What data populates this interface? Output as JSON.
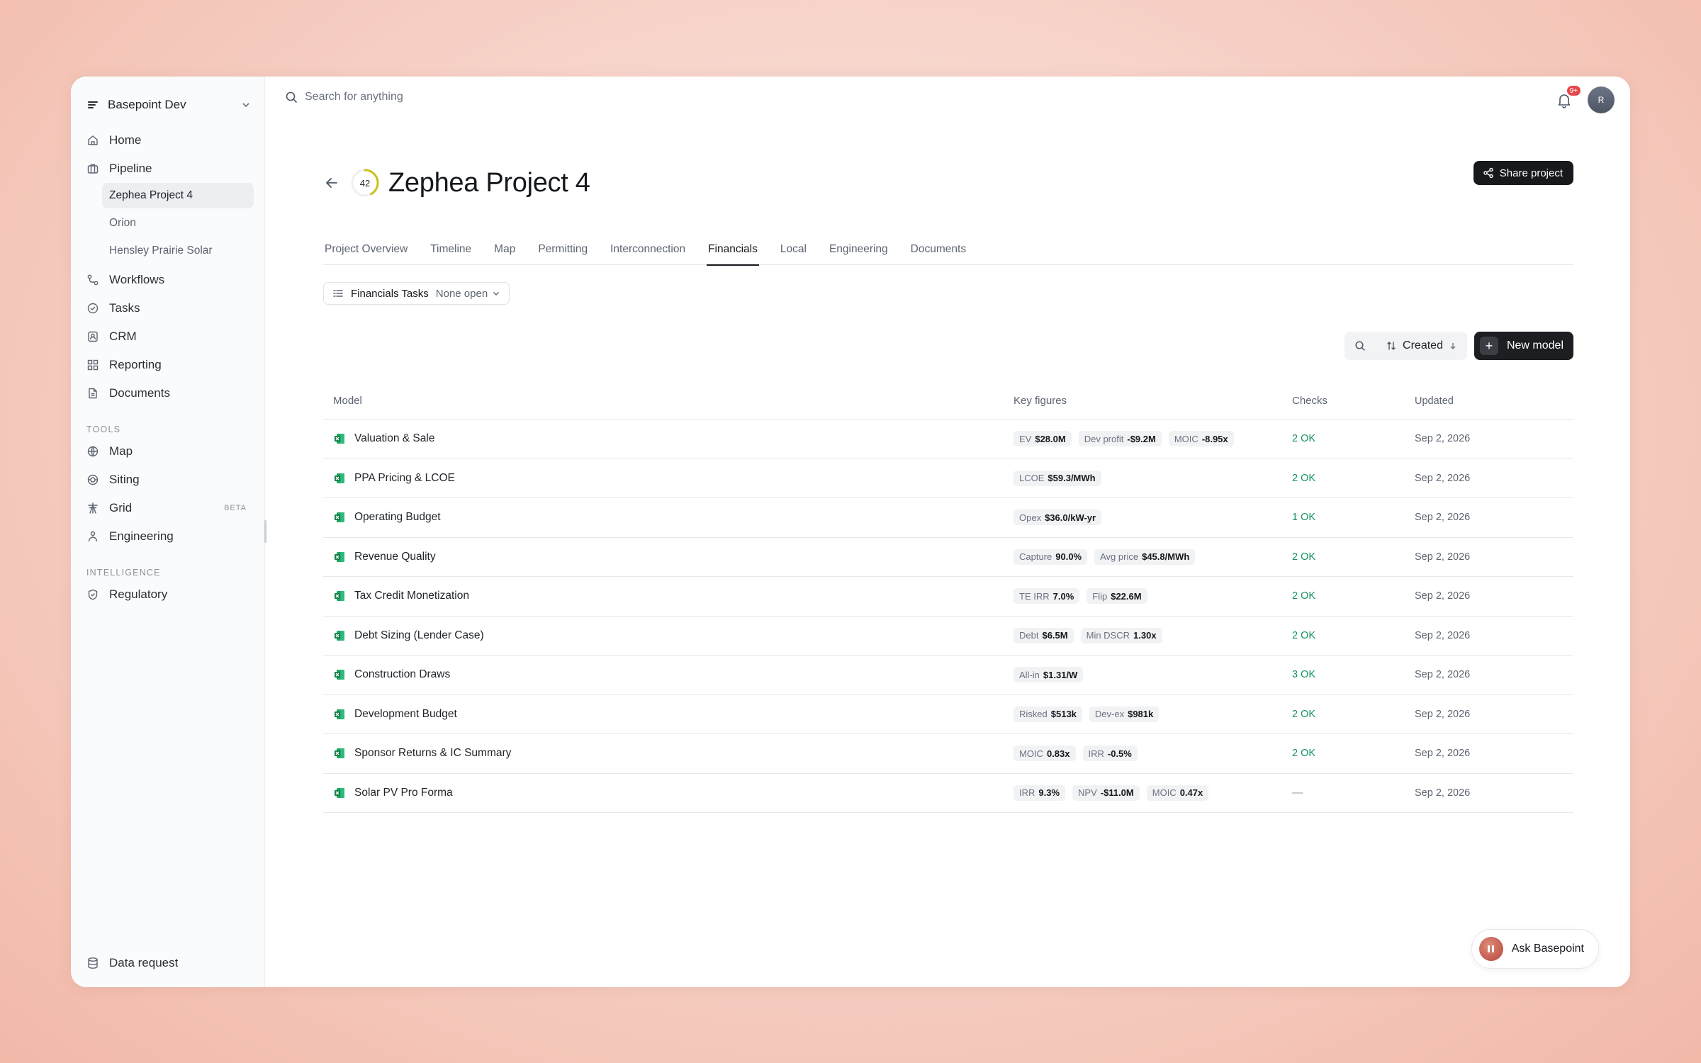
{
  "workspace": {
    "name": "Basepoint Dev"
  },
  "sidebar": {
    "nav": [
      {
        "label": "Home",
        "icon": "home-icon"
      },
      {
        "label": "Pipeline",
        "icon": "briefcase-icon"
      }
    ],
    "pipeline_items": [
      "Zephea Project 4",
      "Orion",
      "Hensley Prairie Solar"
    ],
    "nav2": [
      {
        "label": "Workflows",
        "icon": "workflow-icon"
      },
      {
        "label": "Tasks",
        "icon": "check-circle-icon"
      },
      {
        "label": "CRM",
        "icon": "contact-icon"
      },
      {
        "label": "Reporting",
        "icon": "grid-icon"
      },
      {
        "label": "Documents",
        "icon": "document-icon"
      }
    ],
    "tools_label": "TOOLS",
    "tools": [
      {
        "label": "Map",
        "icon": "globe-icon"
      },
      {
        "label": "Siting",
        "icon": "siting-icon"
      },
      {
        "label": "Grid",
        "icon": "tower-icon",
        "badge": "BETA"
      },
      {
        "label": "Engineering",
        "icon": "engineer-icon"
      }
    ],
    "intelligence_label": "INTELLIGENCE",
    "intelligence": [
      {
        "label": "Regulatory",
        "icon": "shield-icon"
      }
    ],
    "footer": {
      "label": "Data request",
      "icon": "database-icon"
    }
  },
  "topbar": {
    "search_placeholder": "Search for anything",
    "notification_badge": "9+",
    "avatar_initial": "R"
  },
  "project": {
    "score": "42",
    "score_fraction": 0.42,
    "title": "Zephea Project 4",
    "share_label": "Share project"
  },
  "tabs": [
    "Project Overview",
    "Timeline",
    "Map",
    "Permitting",
    "Interconnection",
    "Financials",
    "Local",
    "Engineering",
    "Documents"
  ],
  "active_tab": "Financials",
  "tasks_filter": {
    "label": "Financials Tasks",
    "value": "None open"
  },
  "toolbar": {
    "sort_label": "Created",
    "new_label": "New model"
  },
  "table": {
    "headers": {
      "model": "Model",
      "key": "Key figures",
      "checks": "Checks",
      "updated": "Updated"
    },
    "rows": [
      {
        "model": "Valuation & Sale",
        "figures": [
          {
            "k": "EV",
            "v": "$28.0M"
          },
          {
            "k": "Dev profit",
            "v": "-$9.2M"
          },
          {
            "k": "MOIC",
            "v": "-8.95x"
          }
        ],
        "checks": "2 OK",
        "updated": "Sep 2, 2026"
      },
      {
        "model": "PPA Pricing & LCOE",
        "figures": [
          {
            "k": "LCOE",
            "v": "$59.3/MWh"
          }
        ],
        "checks": "2 OK",
        "updated": "Sep 2, 2026"
      },
      {
        "model": "Operating Budget",
        "figures": [
          {
            "k": "Opex",
            "v": "$36.0/kW-yr"
          }
        ],
        "checks": "1 OK",
        "updated": "Sep 2, 2026"
      },
      {
        "model": "Revenue Quality",
        "figures": [
          {
            "k": "Capture",
            "v": "90.0%"
          },
          {
            "k": "Avg price",
            "v": "$45.8/MWh"
          }
        ],
        "checks": "2 OK",
        "updated": "Sep 2, 2026"
      },
      {
        "model": "Tax Credit Monetization",
        "figures": [
          {
            "k": "TE IRR",
            "v": "7.0%"
          },
          {
            "k": "Flip",
            "v": "$22.6M"
          }
        ],
        "checks": "2 OK",
        "updated": "Sep 2, 2026"
      },
      {
        "model": "Debt Sizing (Lender Case)",
        "figures": [
          {
            "k": "Debt",
            "v": "$6.5M"
          },
          {
            "k": "Min DSCR",
            "v": "1.30x"
          }
        ],
        "checks": "2 OK",
        "updated": "Sep 2, 2026"
      },
      {
        "model": "Construction Draws",
        "figures": [
          {
            "k": "All-in",
            "v": "$1.31/W"
          }
        ],
        "checks": "3 OK",
        "updated": "Sep 2, 2026"
      },
      {
        "model": "Development Budget",
        "figures": [
          {
            "k": "Risked",
            "v": "$513k"
          },
          {
            "k": "Dev-ex",
            "v": "$981k"
          }
        ],
        "checks": "2 OK",
        "updated": "Sep 2, 2026"
      },
      {
        "model": "Sponsor Returns & IC Summary",
        "figures": [
          {
            "k": "MOIC",
            "v": "0.83x"
          },
          {
            "k": "IRR",
            "v": "-0.5%"
          }
        ],
        "checks": "2 OK",
        "updated": "Sep 2, 2026"
      },
      {
        "model": "Solar PV Pro Forma",
        "figures": [
          {
            "k": "IRR",
            "v": "9.3%"
          },
          {
            "k": "NPV",
            "v": "-$11.0M"
          },
          {
            "k": "MOIC",
            "v": "0.47x"
          }
        ],
        "checks": "—",
        "updated": "Sep 2, 2026"
      }
    ]
  },
  "assistant": {
    "label": "Ask Basepoint"
  },
  "colors": {
    "accent_dark": "#17191c",
    "ok_green": "#14935e",
    "badge_red": "#e5484d",
    "score_ring": "#c9c21f"
  }
}
